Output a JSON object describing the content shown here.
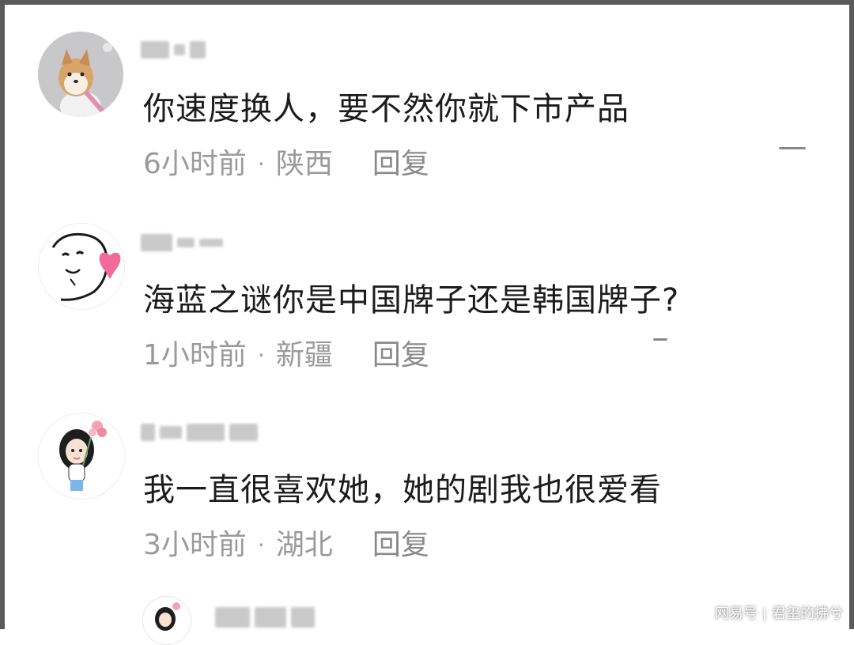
{
  "comments": [
    {
      "avatar_icon": "shiba-dog-avatar-icon",
      "text": "你速度换人，要不然你就下市产品",
      "time": "6小时前",
      "location": "陕西",
      "reply_label": "回复"
    },
    {
      "avatar_icon": "cartoon-face-heart-avatar-icon",
      "text": "海蓝之谜你是中国牌子还是韩国牌子?",
      "time": "1小时前",
      "location": "新疆",
      "reply_label": "回复"
    },
    {
      "avatar_icon": "cartoon-girl-flowers-avatar-icon",
      "text": "我一直很喜欢她，她的剧我也很爱看",
      "time": "3小时前",
      "location": "湖北",
      "reply_label": "回复"
    }
  ],
  "separator": "·",
  "watermark": {
    "platform": "网易号",
    "sep": "|",
    "author": "君玺的拂兮"
  }
}
